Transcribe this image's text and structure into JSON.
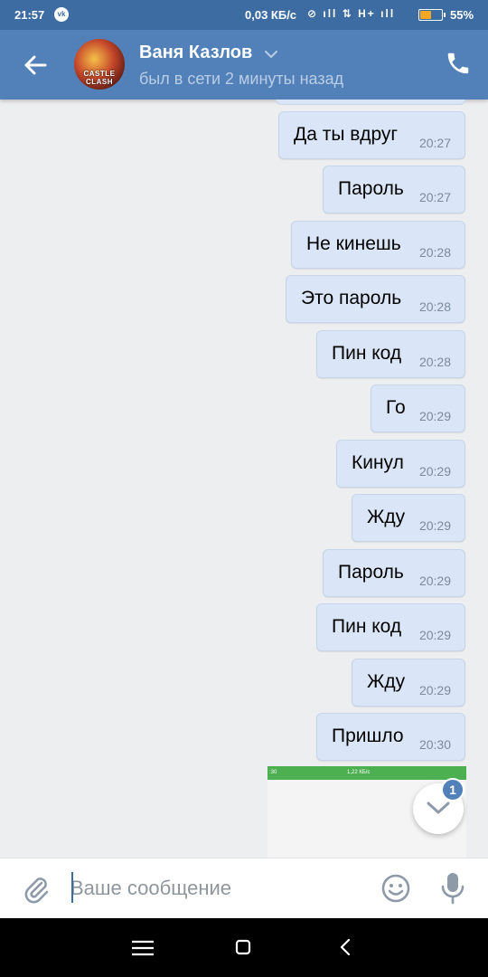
{
  "status_bar": {
    "time": "21:57",
    "speed": "0,03 КБ/с",
    "network": "H+",
    "battery": "55%",
    "battery_level": 0.55
  },
  "header": {
    "contact_name": "Ваня Казлов",
    "contact_status": "был в сети 2 минуты назад",
    "avatar_text": "CASTLE CLASH",
    "icons": [
      "arrow-left-icon",
      "chevron-down-icon",
      "phone-icon"
    ]
  },
  "messages": [
    {
      "text": "Да ты вдруг",
      "time": "20:27"
    },
    {
      "text": "Пароль",
      "time": "20:27"
    },
    {
      "text": "Не кинешь",
      "time": "20:28"
    },
    {
      "text": "Это пароль",
      "time": "20:28"
    },
    {
      "text": "Пин код",
      "time": "20:28"
    },
    {
      "text": "Го",
      "time": "20:29"
    },
    {
      "text": "Кинул",
      "time": "20:29"
    },
    {
      "text": "Жду",
      "time": "20:29"
    },
    {
      "text": "Пароль",
      "time": "20:29"
    },
    {
      "text": "Пин код",
      "time": "20:29"
    },
    {
      "text": "Жду",
      "time": "20:29"
    },
    {
      "text": "Пришло",
      "time": "20:30"
    }
  ],
  "image_preview": {
    "left_text": ":30",
    "right_text": "1,22 КБ/с"
  },
  "scroll_down": {
    "unread_count": "1"
  },
  "composer": {
    "placeholder": "Ваше сообщение",
    "value": ""
  },
  "colors": {
    "header": "#5181b8",
    "status_bar": "#3d6ca3",
    "bubble": "#dae6f7",
    "background": "#edeef0"
  }
}
